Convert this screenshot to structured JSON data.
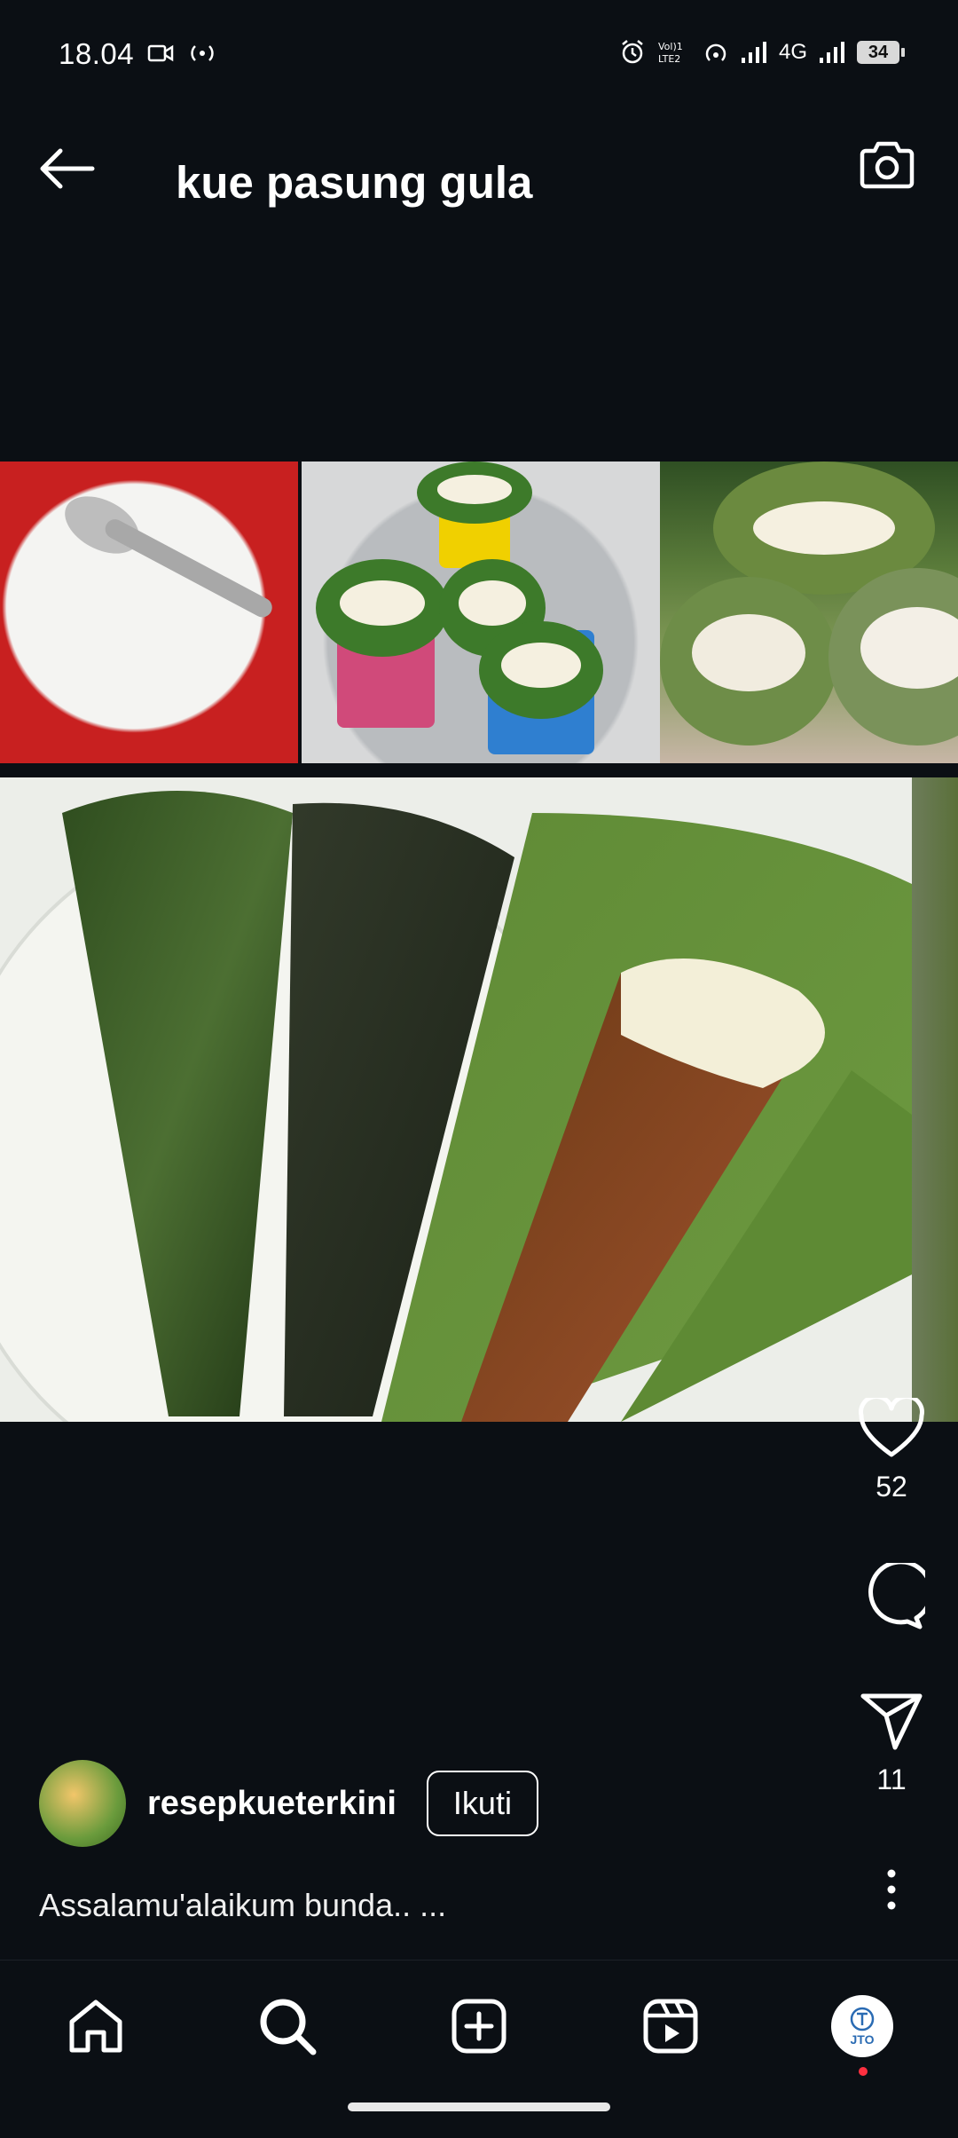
{
  "status_bar": {
    "time": "18.04",
    "network": "4G",
    "volte": "VoLTE2",
    "battery": "34",
    "icons": [
      "video-camera-icon",
      "wireless-signal-icon",
      "alarm-icon",
      "volte-icon",
      "hotspot-icon",
      "signal-bars-icon",
      "signal-bars-icon",
      "battery-icon"
    ]
  },
  "header": {
    "title": "kue pasung gula",
    "back_icon": "arrow-left-icon",
    "camera_icon": "camera-icon"
  },
  "post": {
    "likes": "52",
    "shares": "11",
    "author": "resepkueterkini",
    "follow_label": "Ikuti",
    "caption": "Assalamu'alaikum bunda.. ..."
  },
  "bottom_nav": {
    "items": [
      "home-icon",
      "search-icon",
      "create-post-icon",
      "reels-icon",
      "profile-avatar"
    ],
    "profile_label": "JTO"
  }
}
